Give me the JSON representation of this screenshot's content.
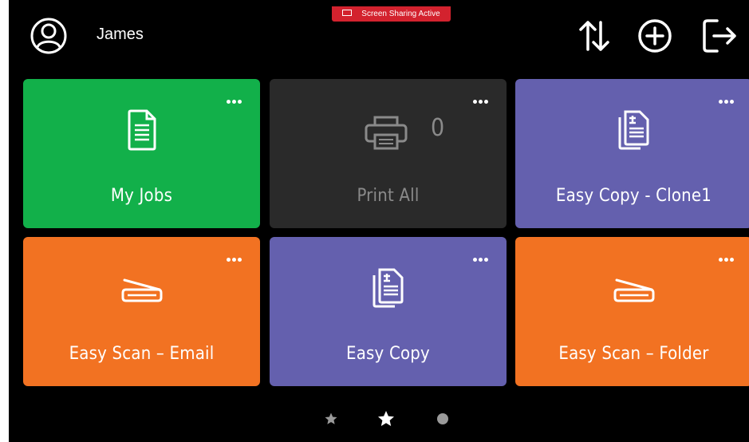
{
  "banner": {
    "text": "Screen Sharing Active"
  },
  "header": {
    "user_name": "James",
    "icons": [
      "user-icon",
      "sort-arrows-icon",
      "plus-circle-icon",
      "logout-icon"
    ]
  },
  "tiles": [
    {
      "label": "My Jobs",
      "color": "#12b04a",
      "icon": "document-icon"
    },
    {
      "label": "Print All",
      "color": "#2a2a2a",
      "icon": "printer-icon",
      "count": "0",
      "disabled": true
    },
    {
      "label": "Easy Copy - Clone1",
      "color": "#6460ae",
      "icon": "copy-icon"
    },
    {
      "label": "Easy Scan – Email",
      "color": "#f27222",
      "icon": "scanner-icon"
    },
    {
      "label": "Easy Copy",
      "color": "#6460ae",
      "icon": "copy-icon"
    },
    {
      "label": "Easy Scan – Folder",
      "color": "#f27222",
      "icon": "scanner-icon"
    }
  ],
  "pagination": {
    "items": [
      "star",
      "star",
      "circle"
    ],
    "active_index": 1
  }
}
